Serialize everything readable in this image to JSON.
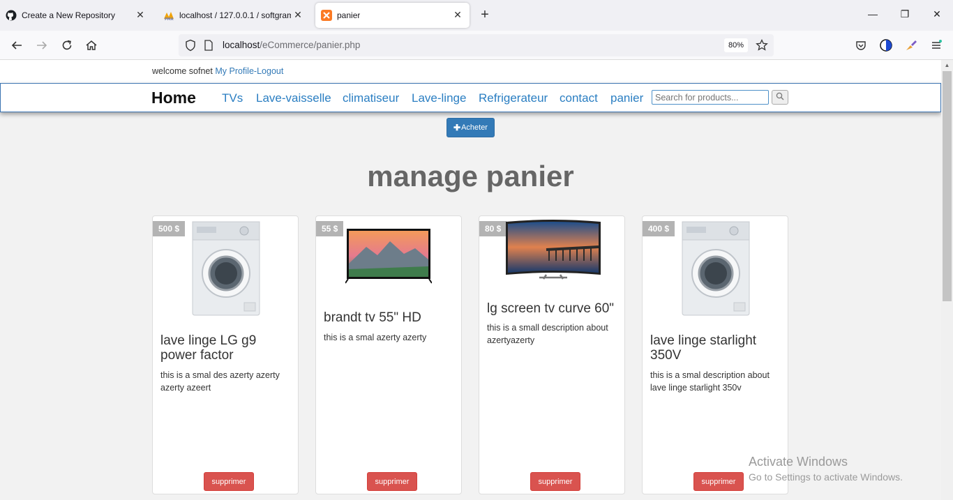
{
  "browser": {
    "tabs": [
      {
        "title": "Create a New Repository",
        "icon": "github-icon"
      },
      {
        "title": "localhost / 127.0.0.1 / softgram",
        "icon": "phpmyadmin-icon"
      },
      {
        "title": "panier",
        "icon": "xampp-icon"
      }
    ],
    "url_host": "localhost",
    "url_path": "/eCommerce/panier.php",
    "zoom": "80%"
  },
  "header": {
    "welcome_text": "welcome sofnet",
    "profile_link": "My Profile",
    "separator": "-",
    "logout_link": "Logout"
  },
  "nav": {
    "brand": "Home",
    "links": [
      "TVs",
      "Lave-vaisselle",
      "climatiseur",
      "Lave-linge",
      "Refrigerateur",
      "contact",
      "panier"
    ],
    "search_placeholder": "Search for products..."
  },
  "acheter_label": "Acheter",
  "page_title": "manage panier",
  "products": [
    {
      "price": "500 $",
      "title": "lave linge LG g9 power factor",
      "description": "this is a smal des azerty azerty azerty azeert",
      "image": "washing-machine",
      "button": "supprimer"
    },
    {
      "price": "55 $",
      "title": "brandt tv 55\" HD",
      "description": "this is a smal azerty azerty",
      "image": "tv-flat",
      "button": "supprimer"
    },
    {
      "price": "80 $",
      "title": "lg screen tv curve 60\"",
      "description": "this is a small description about azertyazerty",
      "image": "tv-curved",
      "button": "supprimer"
    },
    {
      "price": "400 $",
      "title": "lave linge starlight 350V",
      "description": "this is a smal description about lave linge starlight 350v",
      "image": "washing-machine",
      "button": "supprimer"
    }
  ],
  "watermark": {
    "line1": "Activate Windows",
    "line2": "Go to Settings to activate Windows."
  },
  "colors": {
    "primary": "#337ab7",
    "danger": "#d9534f",
    "link": "#2a7ec2",
    "price_tag": "#b3b3b3"
  }
}
